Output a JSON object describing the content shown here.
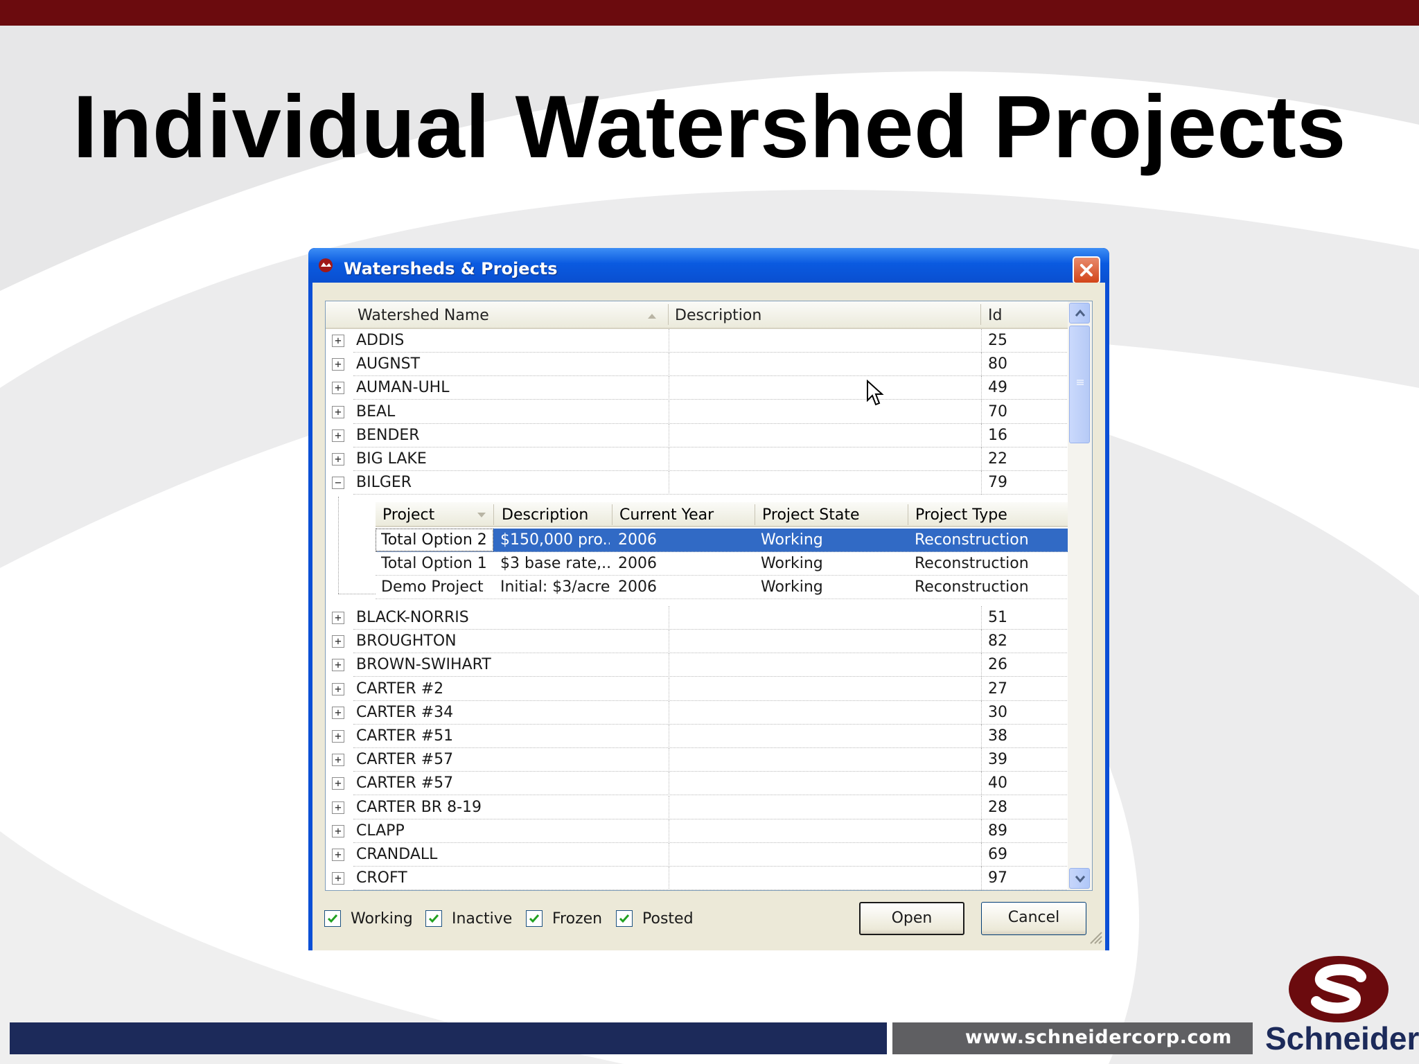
{
  "slide": {
    "title": "Individual Watershed Projects",
    "footer_url": "www.schneidercorp.com",
    "logo_text": "Schneider",
    "colors": {
      "top_bar": "#6b0b0e",
      "footer": "#1c2a5a",
      "footer_url_bg": "#5f5f62",
      "logo": "#6b0b0e"
    }
  },
  "dialog": {
    "title": "Watersheds & Projects",
    "columns": {
      "name": "Watershed Name",
      "description": "Description",
      "id": "Id"
    },
    "rows_before": [
      {
        "name": "ADDIS",
        "id": "25",
        "expander": "+"
      },
      {
        "name": "AUGNST",
        "id": "80",
        "expander": "+"
      },
      {
        "name": "AUMAN-UHL",
        "id": "49",
        "expander": "+"
      },
      {
        "name": "BEAL",
        "id": "70",
        "expander": "+"
      },
      {
        "name": "BENDER",
        "id": "16",
        "expander": "+"
      },
      {
        "name": "BIG LAKE",
        "id": "22",
        "expander": "+"
      },
      {
        "name": "BILGER",
        "id": "79",
        "expander": "−"
      }
    ],
    "child_table": {
      "columns": {
        "project": "Project",
        "description": "Description",
        "year": "Current Year",
        "state": "Project State",
        "type": "Project Type"
      },
      "rows": [
        {
          "project": "Total Option 2",
          "description": "$150,000  pro...",
          "year": "2006",
          "state": "Working",
          "type": "Reconstruction",
          "selected": true
        },
        {
          "project": "Total Option 1",
          "description": "$3 base rate,...",
          "year": "2006",
          "state": "Working",
          "type": "Reconstruction",
          "selected": false
        },
        {
          "project": "Demo Project",
          "description": "Initial: $3/acre...",
          "year": "2006",
          "state": "Working",
          "type": "Reconstruction",
          "selected": false
        }
      ]
    },
    "rows_after": [
      {
        "name": "BLACK-NORRIS",
        "id": "51",
        "expander": "+"
      },
      {
        "name": "BROUGHTON",
        "id": "82",
        "expander": "+"
      },
      {
        "name": "BROWN-SWIHART",
        "id": "26",
        "expander": "+"
      },
      {
        "name": "CARTER #2",
        "id": "27",
        "expander": "+"
      },
      {
        "name": "CARTER #34",
        "id": "30",
        "expander": "+"
      },
      {
        "name": "CARTER #51",
        "id": "38",
        "expander": "+"
      },
      {
        "name": "CARTER #57",
        "id": "39",
        "expander": "+"
      },
      {
        "name": "CARTER #57",
        "id": "40",
        "expander": "+"
      },
      {
        "name": "CARTER BR 8-19",
        "id": "28",
        "expander": "+"
      },
      {
        "name": "CLAPP",
        "id": "89",
        "expander": "+"
      },
      {
        "name": "CRANDALL",
        "id": "69",
        "expander": "+"
      },
      {
        "name": "CROFT",
        "id": "97",
        "expander": "+"
      }
    ],
    "filters": [
      {
        "label": "Working",
        "checked": true
      },
      {
        "label": "Inactive",
        "checked": true
      },
      {
        "label": "Frozen",
        "checked": true
      },
      {
        "label": "Posted",
        "checked": true
      }
    ],
    "buttons": {
      "open": "Open",
      "cancel": "Cancel"
    },
    "selection_color": "#316ac5"
  }
}
